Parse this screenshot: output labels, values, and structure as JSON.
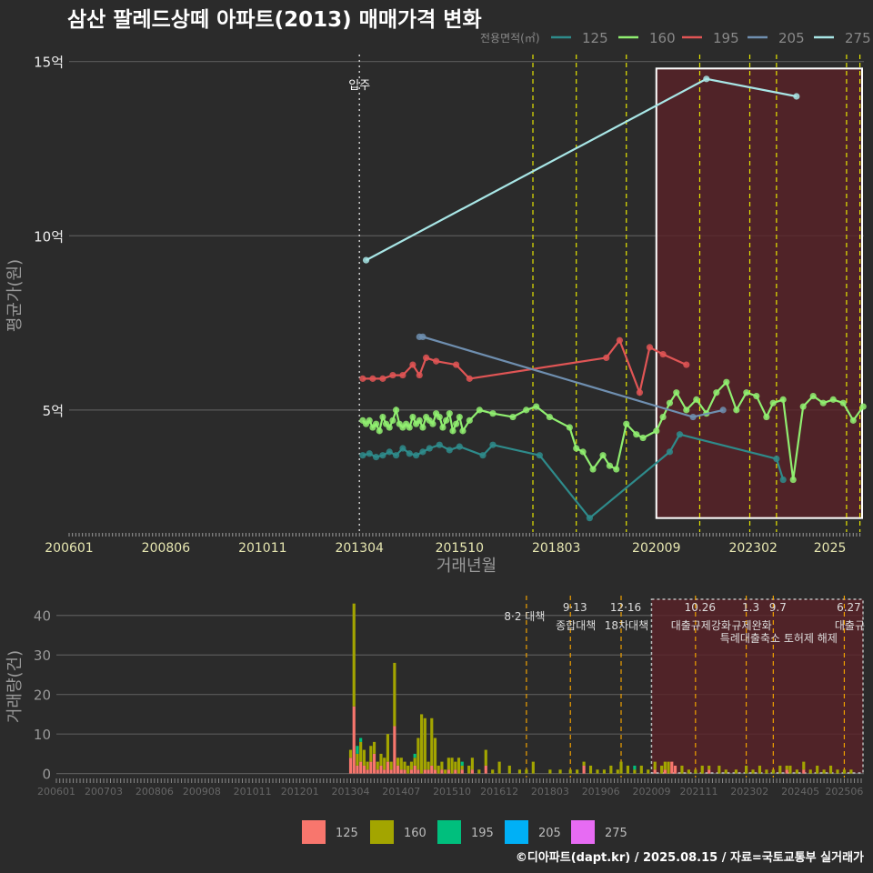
{
  "title": "삼산 팔레드상떼 아파트(2013) 매매가격 변화",
  "footer": "©디아파트(dapt.kr) / 2025.08.15 / 자료=국토교통부 실거래가",
  "colors": {
    "background": "#2b2b2b",
    "grid": "#5a5a5a",
    "highlight_fill": "#5a2228",
    "highlight_border": "#ffffff",
    "policy_line_top": "#e6e600",
    "policy_line_bottom": "#f0a000",
    "text": "#dddddd"
  },
  "chart_data": [
    {
      "type": "line",
      "title": "삼산 팔레드상떼 아파트(2013) 매매가격 변화",
      "xlabel": "거래년월",
      "ylabel": "평균가(원)",
      "legend_title": "전용면적(㎡)",
      "legend_position": "top-right",
      "x_ticks": [
        "200601",
        "200806",
        "201011",
        "201304",
        "201510",
        "201803",
        "202009",
        "202302",
        "2025"
      ],
      "y_ticks": [
        "5억",
        "10억",
        "15억"
      ],
      "y_tick_values": [
        5,
        10,
        15
      ],
      "ylim": [
        1.5,
        15.2
      ],
      "y_unit": "억",
      "move_in_label": "입주",
      "move_in_x": "2013-04",
      "policy_dates": [
        "2017-08",
        "2018-09",
        "2019-12",
        "2021-10",
        "2023-01",
        "2023-09",
        "2025-06",
        "2025-10"
      ],
      "highlight_range": [
        "2020-09",
        "2025-12"
      ],
      "series": [
        {
          "name": "125",
          "color": "#2e8b8b",
          "x": [
            "2013-05",
            "2013-07",
            "2013-09",
            "2013-11",
            "2014-01",
            "2014-03",
            "2014-05",
            "2014-07",
            "2014-09",
            "2014-11",
            "2015-01",
            "2015-04",
            "2015-07",
            "2015-10",
            "2016-05",
            "2016-08",
            "2017-10",
            "2019-01",
            "2021-01",
            "2021-04",
            "2023-09",
            "2023-11"
          ],
          "y": [
            3.7,
            3.75,
            3.65,
            3.7,
            3.8,
            3.7,
            3.9,
            3.75,
            3.7,
            3.8,
            3.9,
            4.0,
            3.85,
            3.95,
            3.7,
            4.0,
            3.7,
            1.9,
            3.8,
            4.3,
            3.6,
            3.0
          ]
        },
        {
          "name": "160",
          "color": "#90ee70",
          "x": [
            "2013-05",
            "2013-06",
            "2013-07",
            "2013-08",
            "2013-09",
            "2013-10",
            "2013-11",
            "2013-12",
            "2014-01",
            "2014-02",
            "2014-03",
            "2014-04",
            "2014-05",
            "2014-06",
            "2014-07",
            "2014-08",
            "2014-09",
            "2014-10",
            "2014-11",
            "2014-12",
            "2015-01",
            "2015-02",
            "2015-03",
            "2015-04",
            "2015-05",
            "2015-06",
            "2015-07",
            "2015-08",
            "2015-09",
            "2015-10",
            "2015-11",
            "2016-01",
            "2016-04",
            "2016-08",
            "2017-02",
            "2017-06",
            "2017-09",
            "2018-01",
            "2018-07",
            "2018-09",
            "2018-11",
            "2019-02",
            "2019-05",
            "2019-07",
            "2019-09",
            "2019-12",
            "2020-03",
            "2020-05",
            "2020-09",
            "2020-11",
            "2021-01",
            "2021-03",
            "2021-06",
            "2021-09",
            "2021-12",
            "2022-03",
            "2022-06",
            "2022-09",
            "2022-12",
            "2023-03",
            "2023-06",
            "2023-08",
            "2023-11",
            "2024-02",
            "2024-05",
            "2024-08",
            "2024-11",
            "2025-02",
            "2025-05",
            "2025-08",
            "2025-11"
          ],
          "y": [
            4.7,
            4.6,
            4.7,
            4.5,
            4.6,
            4.4,
            4.8,
            4.6,
            4.5,
            4.7,
            5.0,
            4.6,
            4.5,
            4.6,
            4.5,
            4.8,
            4.6,
            4.7,
            4.5,
            4.8,
            4.7,
            4.6,
            4.9,
            4.8,
            4.5,
            4.7,
            4.9,
            4.4,
            4.6,
            4.8,
            4.4,
            4.7,
            5.0,
            4.9,
            4.8,
            5.0,
            5.1,
            4.8,
            4.5,
            3.9,
            3.8,
            3.3,
            3.7,
            3.4,
            3.3,
            4.6,
            4.3,
            4.2,
            4.4,
            4.8,
            5.2,
            5.5,
            5.0,
            5.3,
            4.9,
            5.5,
            5.8,
            5.0,
            5.5,
            5.4,
            4.8,
            5.2,
            5.3,
            3.0,
            5.1,
            5.4,
            5.2,
            5.3,
            5.2,
            4.7,
            5.1
          ]
        },
        {
          "name": "195",
          "color": "#e05555",
          "x": [
            "2013-05",
            "2013-08",
            "2013-11",
            "2014-02",
            "2014-05",
            "2014-08",
            "2014-10",
            "2014-12",
            "2015-03",
            "2015-09",
            "2016-01",
            "2019-06",
            "2019-10",
            "2020-04",
            "2020-07",
            "2020-11",
            "2021-06"
          ],
          "y": [
            5.9,
            5.9,
            5.9,
            6.0,
            6.0,
            6.3,
            6.0,
            6.5,
            6.4,
            6.3,
            5.9,
            6.5,
            7.0,
            5.5,
            6.8,
            6.6,
            6.3
          ]
        },
        {
          "name": "205",
          "color": "#6f8fb0",
          "x": [
            "2014-10",
            "2014-11",
            "2021-08",
            "2022-05"
          ],
          "y": [
            7.1,
            7.1,
            4.8,
            5.0
          ]
        },
        {
          "name": "275",
          "color": "#a8e6e6",
          "x": [
            "2013-06",
            "2021-12",
            "2024-03"
          ],
          "y": [
            9.3,
            14.5,
            14.0
          ]
        }
      ]
    },
    {
      "type": "bar",
      "stacked": true,
      "ylabel": "거래량(건)",
      "y_ticks": [
        "0",
        "10",
        "20",
        "30",
        "40"
      ],
      "y_tick_values": [
        0,
        10,
        20,
        30,
        40
      ],
      "ylim": [
        -1,
        45
      ],
      "x_ticks": [
        "200601",
        "200703",
        "200806",
        "200908",
        "201011",
        "201201",
        "201304",
        "201407",
        "201510",
        "201612",
        "201803",
        "201906",
        "202009",
        "202111",
        "202302",
        "202405",
        "202506"
      ],
      "legend_position": "bottom",
      "legend": [
        {
          "name": "125",
          "color": "#f8766d"
        },
        {
          "name": "160",
          "color": "#a3a500"
        },
        {
          "name": "195",
          "color": "#00bf7d"
        },
        {
          "name": "205",
          "color": "#00b0f6"
        },
        {
          "name": "275",
          "color": "#e76bf3"
        }
      ],
      "policies": [
        {
          "date": "2017-08",
          "label": "8·2 대책",
          "label2": ""
        },
        {
          "date": "2018-09",
          "label": "9·13",
          "label2": "종합대책"
        },
        {
          "date": "2019-12",
          "label": "12·16",
          "label2": "18차대책"
        },
        {
          "date": "2021-10",
          "label": "10.26",
          "label2": "대출규제강화"
        },
        {
          "date": "2023-01",
          "label": "1.3",
          "label2": "규제완화"
        },
        {
          "date": "2023-09",
          "label": "9.7",
          "label2": "특례대출축소 토허제 해제"
        },
        {
          "date": "2025-06",
          "label": "6.27",
          "label2": "대출규"
        }
      ],
      "highlight_range": [
        "2020-09",
        "2025-12"
      ],
      "data": [
        {
          "date": "2013-04",
          "v125": 4,
          "v160": 2
        },
        {
          "date": "2013-05",
          "v125": 17,
          "v160": 26
        },
        {
          "date": "2013-06",
          "v125": 2,
          "v160": 3,
          "v195": 2
        },
        {
          "date": "2013-07",
          "v125": 3,
          "v160": 5,
          "v195": 1
        },
        {
          "date": "2013-08",
          "v125": 2,
          "v160": 4
        },
        {
          "date": "2013-09",
          "v125": 1,
          "v160": 2
        },
        {
          "date": "2013-10",
          "v125": 3,
          "v160": 4
        },
        {
          "date": "2013-11",
          "v125": 5,
          "v160": 3
        },
        {
          "date": "2013-12",
          "v125": 1,
          "v160": 2
        },
        {
          "date": "2014-01",
          "v125": 2,
          "v160": 3
        },
        {
          "date": "2014-02",
          "v125": 1,
          "v160": 3
        },
        {
          "date": "2014-03",
          "v125": 3,
          "v160": 7
        },
        {
          "date": "2014-04",
          "v125": 1,
          "v160": 2
        },
        {
          "date": "2014-05",
          "v125": 12,
          "v160": 16
        },
        {
          "date": "2014-06",
          "v125": 2,
          "v160": 2
        },
        {
          "date": "2014-07",
          "v125": 1,
          "v160": 3
        },
        {
          "date": "2014-08",
          "v125": 1,
          "v160": 2
        },
        {
          "date": "2014-09",
          "v160": 2
        },
        {
          "date": "2014-10",
          "v125": 1,
          "v160": 2
        },
        {
          "date": "2014-11",
          "v125": 2,
          "v160": 2,
          "v195": 1
        },
        {
          "date": "2014-12",
          "v125": 1,
          "v160": 8
        },
        {
          "date": "2015-01",
          "v160": 15
        },
        {
          "date": "2015-02",
          "v125": 1,
          "v160": 13
        },
        {
          "date": "2015-03",
          "v125": 1,
          "v160": 2
        },
        {
          "date": "2015-04",
          "v125": 2,
          "v160": 12
        },
        {
          "date": "2015-05",
          "v125": 1,
          "v160": 8
        },
        {
          "date": "2015-06",
          "v160": 2
        },
        {
          "date": "2015-07",
          "v125": 1,
          "v160": 2
        },
        {
          "date": "2015-08",
          "v160": 1
        },
        {
          "date": "2015-09",
          "v125": 1,
          "v160": 3
        },
        {
          "date": "2015-10",
          "v160": 4
        },
        {
          "date": "2015-11",
          "v125": 1,
          "v160": 2
        },
        {
          "date": "2015-12",
          "v160": 4
        },
        {
          "date": "2016-01",
          "v125": 1,
          "v160": 1,
          "v195": 1
        },
        {
          "date": "2016-03",
          "v160": 2
        },
        {
          "date": "2016-04",
          "v125": 1,
          "v160": 3
        },
        {
          "date": "2016-06",
          "v160": 1
        },
        {
          "date": "2016-08",
          "v125": 2,
          "v160": 4
        },
        {
          "date": "2016-10",
          "v160": 1
        },
        {
          "date": "2016-12",
          "v160": 3
        },
        {
          "date": "2017-03",
          "v160": 2
        },
        {
          "date": "2017-06",
          "v160": 1
        },
        {
          "date": "2017-08",
          "v160": 1
        },
        {
          "date": "2017-10",
          "v160": 3
        },
        {
          "date": "2018-03",
          "v160": 1
        },
        {
          "date": "2018-06",
          "v160": 1
        },
        {
          "date": "2018-09",
          "v160": 1
        },
        {
          "date": "2018-11",
          "v160": 1
        },
        {
          "date": "2019-01",
          "v160": 1,
          "v125": 2
        },
        {
          "date": "2019-03",
          "v160": 2
        },
        {
          "date": "2019-05",
          "v160": 1
        },
        {
          "date": "2019-07",
          "v160": 1
        },
        {
          "date": "2019-09",
          "v160": 2
        },
        {
          "date": "2019-11",
          "v160": 1
        },
        {
          "date": "2019-12",
          "v160": 3
        },
        {
          "date": "2020-02",
          "v160": 2
        },
        {
          "date": "2020-04",
          "v160": 1,
          "v195": 1
        },
        {
          "date": "2020-06",
          "v160": 2
        },
        {
          "date": "2020-08",
          "v160": 1
        },
        {
          "date": "2020-10",
          "v160": 2,
          "v125": 1
        },
        {
          "date": "2020-12",
          "v160": 2
        },
        {
          "date": "2021-01",
          "v125": 1,
          "v160": 2
        },
        {
          "date": "2021-02",
          "v160": 3
        },
        {
          "date": "2021-03",
          "v125": 3
        },
        {
          "date": "2021-04",
          "v125": 2
        },
        {
          "date": "2021-06",
          "v160": 2
        },
        {
          "date": "2021-08",
          "v160": 1
        },
        {
          "date": "2021-10",
          "v160": 1
        },
        {
          "date": "2021-12",
          "v160": 2
        },
        {
          "date": "2022-02",
          "v125": 1,
          "v160": 1
        },
        {
          "date": "2022-05",
          "v160": 2
        },
        {
          "date": "2022-07",
          "v160": 1
        },
        {
          "date": "2022-10",
          "v160": 1
        },
        {
          "date": "2023-01",
          "v160": 2
        },
        {
          "date": "2023-03",
          "v160": 1
        },
        {
          "date": "2023-05",
          "v160": 2
        },
        {
          "date": "2023-07",
          "v160": 1
        },
        {
          "date": "2023-09",
          "v160": 1
        },
        {
          "date": "2023-11",
          "v160": 2
        },
        {
          "date": "2024-01",
          "v160": 1,
          "v125": 1
        },
        {
          "date": "2024-02",
          "v160": 2
        },
        {
          "date": "2024-04",
          "v160": 1
        },
        {
          "date": "2024-06",
          "v160": 2,
          "v125": 1
        },
        {
          "date": "2024-08",
          "v160": 1
        },
        {
          "date": "2024-10",
          "v160": 2
        },
        {
          "date": "2024-12",
          "v160": 1
        },
        {
          "date": "2025-02",
          "v160": 2
        },
        {
          "date": "2025-04",
          "v160": 1
        },
        {
          "date": "2025-06",
          "v160": 1
        },
        {
          "date": "2025-08",
          "v160": 1
        }
      ]
    }
  ]
}
